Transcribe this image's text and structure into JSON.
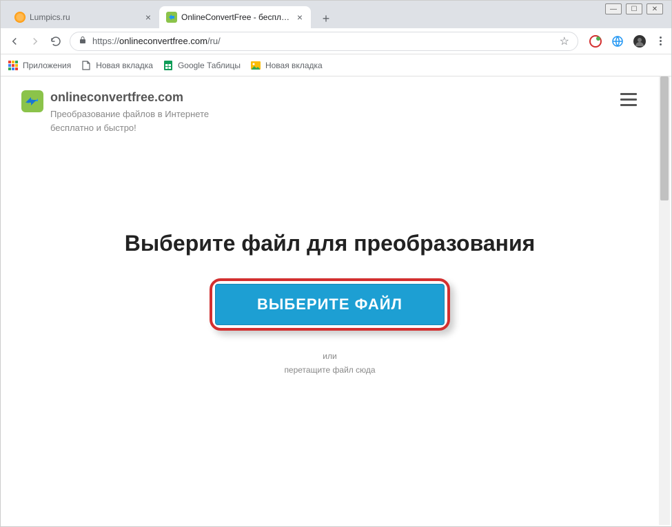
{
  "window_controls": {
    "minimize": "—",
    "maximize": "☐",
    "close": "✕"
  },
  "tabs": [
    {
      "title": "Lumpics.ru",
      "active": false
    },
    {
      "title": "OnlineConvertFree - бесплатный",
      "active": true
    }
  ],
  "new_tab_label": "+",
  "address_bar": {
    "scheme": "https://",
    "host": "onlineconvertfree.com",
    "path": "/ru/"
  },
  "bookmarks": [
    {
      "label": "Приложения",
      "icon": "apps"
    },
    {
      "label": "Новая вкладка",
      "icon": "file"
    },
    {
      "label": "Google Таблицы",
      "icon": "sheets"
    },
    {
      "label": "Новая вкладка",
      "icon": "image"
    }
  ],
  "site": {
    "title": "onlineconvertfree.com",
    "subtitle_line1": "Преобразование файлов в Интернете",
    "subtitle_line2": "бесплатно и быстро!"
  },
  "main": {
    "heading": "Выберите файл для преобразования",
    "button_label": "ВЫБЕРИТЕ ФАЙЛ",
    "or_text": "или",
    "drag_text": "перетащите файл сюда"
  }
}
